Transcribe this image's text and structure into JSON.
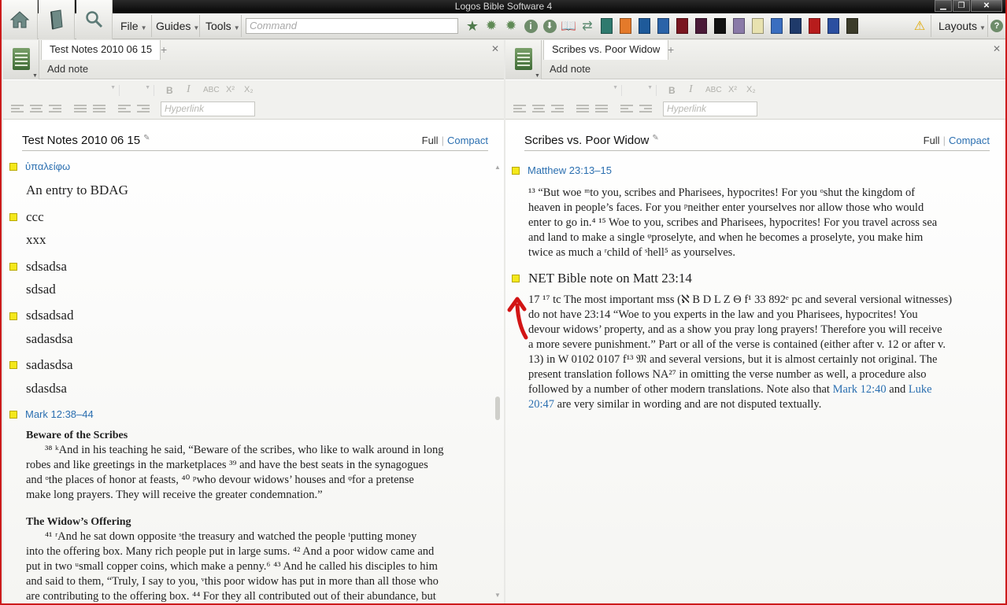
{
  "app": {
    "title": "Logos Bible Software 4"
  },
  "toolbar": {
    "menus": [
      "File",
      "Guides",
      "Tools"
    ],
    "command_placeholder": "Command",
    "layouts_label": "Layouts"
  },
  "colors": {
    "accent_link": "#2b6fb0",
    "highlight_marker": "#f4e81b",
    "frame_red": "#cc1b1b"
  },
  "format_bar": {
    "hyperlink_placeholder": "Hyperlink",
    "buttons": [
      "B",
      "I",
      "ABC",
      "X²",
      "X₂"
    ]
  },
  "left": {
    "tab_label": "Test Notes 2010 06 15",
    "add_note": "Add note",
    "doc_title": "Test Notes 2010 06 15",
    "view_full": "Full",
    "view_compact": "Compact",
    "notes": [
      {
        "anchor": "ὑπαλείφω",
        "text": "An entry to BDAG"
      },
      {
        "anchor": "ccc",
        "text": "xxx"
      },
      {
        "anchor": "sdsadsa",
        "text": "sdsad"
      },
      {
        "anchor": "sdsadsad",
        "text": "sadasdsa"
      },
      {
        "anchor": "sadasdsa",
        "text": "sdasdsa"
      }
    ],
    "passage_ref": "Mark 12:38–44",
    "heading1": "Beware of the Scribes",
    "para1_lines": [
      "³⁸ ᵏAnd in his teaching he said, “Beware of the scribes, who like to walk around in long",
      "robes and like greetings in the marketplaces ³⁹ and have the best seats in the synagogues",
      "and ᵒthe places of honor at feasts, ⁴⁰ ᵖwho devour widows’ houses and ᵠfor a pretense",
      "make long prayers. They will receive the greater condemnation.”"
    ],
    "heading2": "The Widow’s Offering",
    "para2_lines": [
      "⁴¹ ʳAnd he sat down opposite ˢthe treasury and watched the people ᵗputting money",
      "into the offering box. Many rich people put in large sums. ⁴² And a poor widow came and",
      "put in two ᵘsmall copper coins, which make a penny.⁶ ⁴³ And he called his disciples to him",
      "and said to them, “Truly, I say to you, ᵛthis poor widow has put in more than all those who",
      "are contributing to the offering box. ⁴⁴ For they all contributed out of their abundance, but"
    ]
  },
  "right": {
    "tab_label": "Scribes vs. Poor Widow",
    "add_note": "Add note",
    "doc_title": "Scribes vs. Poor Widow",
    "view_full": "Full",
    "view_compact": "Compact",
    "passage_ref": "Matthew 23:13–15",
    "passage_lines": [
      "¹³ “But woe ᵐto you, scribes and Pharisees, hypocrites! For you ᵒshut the kingdom of",
      "heaven in people’s faces. For you ᵖneither enter yourselves nor allow those who would",
      "enter to go in.⁴ ¹⁵ Woe to you, scribes and Pharisees, hypocrites! For you travel across sea",
      "and land to make a single ᵠproselyte, and when he becomes a proselyte, you make him",
      "twice as much a ʳchild of ˢhell⁵ as yourselves."
    ],
    "note_title": "NET Bible note on Matt 23:14",
    "note_lines": [
      "17 ¹⁷ tc The most important mss (ℵ B D L Z Θ f¹ 33 892ᵉ pc and several versional witnesses)",
      "do not have 23:14 “Woe to you experts in the law and you Pharisees, hypocrites! You",
      "devour widows’ property, and as a show you pray long prayers! Therefore you will receive",
      "a more severe punishment.” Part or all of the verse is contained (either after v. 12 or after v.",
      "13) in W 0102 0107 f¹³ 𝔐 and several versions, but it is almost certainly not original. The",
      "present translation follows NA²⁷ in omitting the verse number as well, a procedure also",
      "followed by a number of other modern translations. Note also that"
    ],
    "link1": "Mark 12:40",
    "and_text": "and",
    "link2a": "Luke",
    "link2b": "20:47",
    "tail_text": "are very similar in wording and are not disputed textually."
  }
}
